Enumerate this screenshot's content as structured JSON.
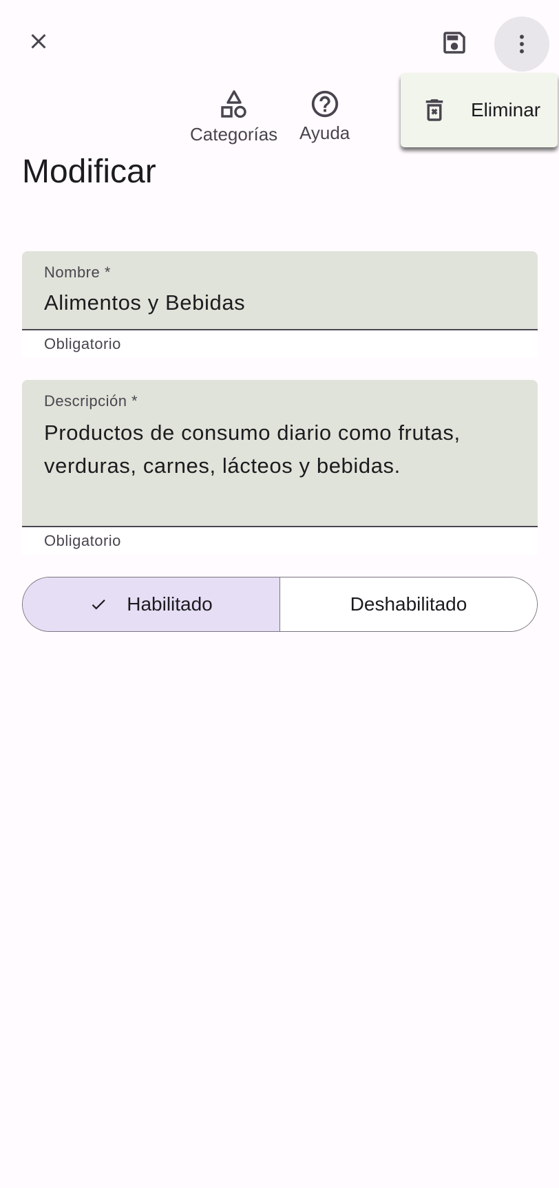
{
  "toolbar": {
    "close_icon": "close-icon",
    "save_icon": "save-icon",
    "more_icon": "more-vert-icon"
  },
  "actions": [
    {
      "label": "Categorías",
      "icon": "category-shapes-icon"
    },
    {
      "label": "Ayuda",
      "icon": "help-circle-icon"
    }
  ],
  "page": {
    "title": "Modificar"
  },
  "menu": {
    "items": [
      {
        "label": "Eliminar",
        "icon": "delete-forever-icon"
      }
    ]
  },
  "form": {
    "name": {
      "label": "Nombre *",
      "value": "Alimentos y Bebidas",
      "helper": "Obligatorio"
    },
    "description": {
      "label": "Descripción *",
      "value": "Productos de consumo diario como frutas, verduras, carnes, lácteos y bebidas.",
      "helper": "Obligatorio"
    }
  },
  "status": {
    "options": [
      "Habilitado",
      "Deshabilitado"
    ],
    "selected": "Habilitado"
  },
  "colors": {
    "background": "#fffbfe",
    "field_fill": "#e0e3d9",
    "menu_fill": "#f1f5ec",
    "selected_segment": "#e6def5",
    "icon": "#49454f"
  }
}
